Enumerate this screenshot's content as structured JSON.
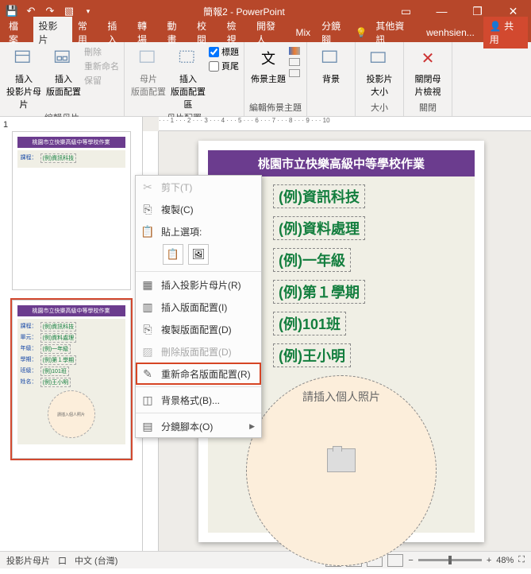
{
  "app": {
    "title": "簡報2 - PowerPoint"
  },
  "qat": {
    "save": "儲存",
    "undo": "復原",
    "redo": "取消復原",
    "start": "從首張投影片"
  },
  "win": {
    "ribbon_opts": "▭",
    "min": "—",
    "restore": "❐",
    "close": "✕"
  },
  "tabs": {
    "file": "檔案",
    "slide": "投影片",
    "home": "常用",
    "insert": "插入",
    "transition": "轉場",
    "anim": "動畫",
    "review": "校閱",
    "view": "檢視",
    "dev": "開發人",
    "mix": "Mix",
    "split": "分鏡腳",
    "tellme": "其他資訊",
    "user": "wenhsien...",
    "share": "共用"
  },
  "ribbon": {
    "g1": {
      "btn1": "插入\n投影片母片",
      "btn2": "插入\n版面配置",
      "label": "編輯母片",
      "sub_rename": "重新命名",
      "sub_preserve": "保留",
      "sub_delete": "刪除"
    },
    "g2": {
      "btn1": "母片\n版面配置",
      "btn2": "插入\n版面配置區",
      "chk1": "標題",
      "chk2": "頁尾",
      "label": "母片配置"
    },
    "g3": {
      "btn1": "佈景主題",
      "label": "編輯佈景主題"
    },
    "g4": {
      "btn1": "背景",
      "label": " "
    },
    "g5": {
      "btn1": "投影片\n大小",
      "label": "大小"
    },
    "g6": {
      "btn1": "關閉母\n片檢視",
      "label": "關閉"
    }
  },
  "slide": {
    "title": "桃園市立快樂高級中等學校作業",
    "rows": [
      {
        "lbl": "課程：",
        "val": "(例)資訊科技"
      },
      {
        "lbl": "單元：",
        "val": "(例)資料處理"
      },
      {
        "lbl": "年級：",
        "val": "(例)一年級"
      },
      {
        "lbl": "學期：",
        "val": "(例)第１學期"
      },
      {
        "lbl": "班級：",
        "val": "(例)101班"
      },
      {
        "lbl": "姓名：",
        "val": "(例)王小明"
      }
    ],
    "photo_hint": "請插入個人照片"
  },
  "thumb": {
    "num": "1",
    "circle_hint": "請插入個人照片"
  },
  "menu": {
    "cut": "剪下(T)",
    "copy": "複製(C)",
    "paste_label": "貼上選項:",
    "insert_master": "插入投影片母片(R)",
    "insert_layout": "插入版面配置(I)",
    "dup_layout": "複製版面配置(D)",
    "del_layout": "刪除版面配置(D)",
    "rename_layout": "重新命名版面配置(R)",
    "bg_format": "背景格式(B)...",
    "storyboard": "分鏡腳本(O)"
  },
  "status": {
    "mode": "投影片母片",
    "lang_icon": "口",
    "lang": "中文 (台灣)",
    "zoom": "48%",
    "fit": "⛶"
  }
}
